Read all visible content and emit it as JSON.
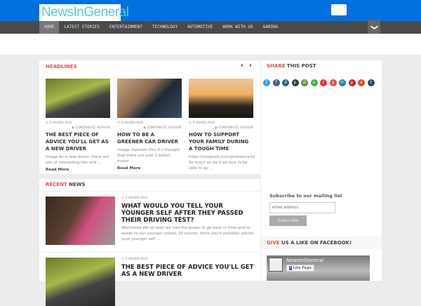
{
  "header": {
    "logo": "NewsInGeneral"
  },
  "nav": {
    "items": [
      "HOME",
      "LATEST STORIES",
      "ENTERTAINMENT",
      "TECHNOLOGY",
      "AUTOMOTIVE",
      "WORK WITH US",
      "GAMING"
    ],
    "more": "❯"
  },
  "headlines": {
    "label_accent": "HEADLINES",
    "prev": "‹",
    "next": "›",
    "cards": [
      {
        "time": "4 HOURS AGO",
        "author": "CONTRIBUTE AUTHOR",
        "title": "THE BEST PIECE OF ADVICE YOU'LL GET AS A NEW DRIVER",
        "excerpt": "Image As a new driver, there are lots of interesting bits and ...",
        "more": "Read More",
        "img": "linear-gradient(160deg,#6b7a2a,#a8b84a 40%,#444 60%,#2a2a2a)"
      },
      {
        "time": "4 HOURS AGO",
        "author": "CONTRIBUTE AUTHOR",
        "title": "HOW TO BE A GREENER CAR DRIVER",
        "excerpt": "Image: Kaboom Pics It's thought that there are over 1 billion motor ...",
        "more": "Read More",
        "img": "linear-gradient(135deg,#c9a37a,#8a6a50 40%,#1f2a35 60%,#3b4c60)"
      },
      {
        "time": "5 HOURS AGO",
        "author": "CONTRIBUTE AUTHOR",
        "title": "HOW TO SUPPORT YOUR FAMILY DURING A TOUGH TIME",
        "excerpt": "https://unsplash.com/photos/cw32 As much as we'd all love to be able to go ...",
        "more": "",
        "img": "linear-gradient(180deg,#e8c79a,#f0b060 40%,#2a2520 70%,#1a1612)"
      }
    ]
  },
  "recent": {
    "label_accent": "RECENT",
    "label_rest": " NEWS",
    "items": [
      {
        "time": "4 HOURS AGO",
        "title": "WHAT WOULD YOU TELL YOUR YOUNGER SELF AFTER THEY PASSED THEIR DRIVING TEST?",
        "excerpt": "Wikimedia We all wish we had the power to go back in time and to speak to our younger selves. Of course, while you'd probably advise your younger self ...",
        "img": "linear-gradient(120deg,#3a2a20,#5a4030 40%,#d05080 60%,#999)"
      },
      {
        "time": "4 HOURS AGO",
        "title": "THE BEST PIECE OF ADVICE YOU'LL GET AS A NEW DRIVER",
        "excerpt": "",
        "img": "linear-gradient(160deg,#6b7a2a,#a8b84a 40%,#444 60%,#2a2a2a)"
      }
    ]
  },
  "sidebar": {
    "share": {
      "accent": "SHARE",
      "rest": " THIS POST",
      "icons": [
        {
          "name": "twitter",
          "color": "#2aa3ef",
          "g": "t"
        },
        {
          "name": "facebook",
          "color": "#3b5998",
          "g": "f"
        },
        {
          "name": "delicious",
          "color": "#2a5a9a",
          "g": "d"
        },
        {
          "name": "print",
          "color": "#333",
          "g": "p"
        },
        {
          "name": "email",
          "color": "#5a8a3a",
          "g": "@"
        },
        {
          "name": "sms",
          "color": "#3cb33c",
          "g": "o"
        },
        {
          "name": "reddit",
          "color": "#ee3322",
          "g": "r"
        },
        {
          "name": "google-plus",
          "color": "#dd4b39",
          "g": "g"
        },
        {
          "name": "linkedin",
          "color": "#1a7bb9",
          "g": "in"
        },
        {
          "name": "pinterest",
          "color": "#cb2027",
          "g": "p"
        },
        {
          "name": "stumbleupon",
          "color": "#eb4924",
          "g": "s"
        },
        {
          "name": "tumblr",
          "color": "#2c4762",
          "g": "t"
        }
      ]
    },
    "subscribe": {
      "label": "Subscribe to our mailing list",
      "placeholder": "email address",
      "button": "Subscribe"
    },
    "facebook": {
      "accent": "GIVE",
      "rest": " US A LIKE ON FACEBOOK!",
      "page": "NewsInGeneral",
      "like": "Like Page"
    }
  }
}
